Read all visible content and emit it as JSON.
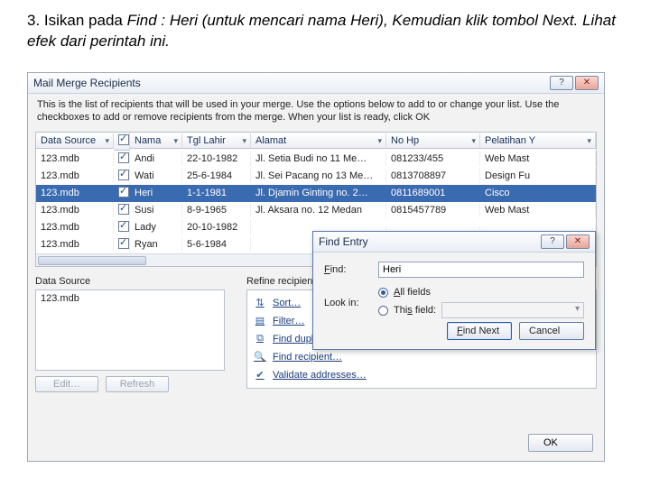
{
  "instruction": {
    "prefix": "3. Isikan pada ",
    "find_label": "Find",
    "middle": " : Heri (untuk mencari nama Heri), Kemudian klik tombol Next. Lihat efek dari perintah ini."
  },
  "main_dialog": {
    "title": "Mail Merge Recipients",
    "help_btn": "?",
    "close_btn": "✕",
    "intro": "This is the list of recipients that will be used in your merge. Use the options below to add to or change your list. Use the checkboxes to add or remove recipients from the merge. When your list is ready, click OK",
    "columns": [
      "Data Source",
      "",
      "Nama",
      "Tgl Lahir",
      "Alamat",
      "No Hp",
      "Pelatihan Y"
    ],
    "rows": [
      {
        "src": "123.mdb",
        "chk": true,
        "nama": "Andi",
        "tgl": "22-10-1982",
        "alamat": "Jl. Setia Budi no 11 Me…",
        "hp": "081233/455",
        "pel": "Web Mast"
      },
      {
        "src": "123.mdb",
        "chk": true,
        "nama": "Wati",
        "tgl": "25-6-1984",
        "alamat": "Jl. Sei Pacang no 13 Me…",
        "hp": "0813708897",
        "pel": "Design Fu"
      },
      {
        "src": "123.mdb",
        "chk": true,
        "nama": "Heri",
        "tgl": "1-1-1981",
        "alamat": "Jl. Djamin Ginting no. 2…",
        "hp": "0811689001",
        "pel": "Cisco",
        "selected": true
      },
      {
        "src": "123.mdb",
        "chk": true,
        "nama": "Susi",
        "tgl": "8-9-1965",
        "alamat": "Jl. Aksara no. 12 Medan",
        "hp": "0815457789",
        "pel": "Web Mast"
      },
      {
        "src": "123.mdb",
        "chk": true,
        "nama": "Lady",
        "tgl": "20-10-1982",
        "alamat": "",
        "hp": "",
        "pel": ""
      },
      {
        "src": "123.mdb",
        "chk": true,
        "nama": "Ryan",
        "tgl": "5-6-1984",
        "alamat": "",
        "hp": "",
        "pel": ""
      }
    ],
    "data_source_label": "Data Source",
    "data_source_item": "123.mdb",
    "edit_btn": "Edit…",
    "refresh_btn": "Refresh",
    "refine_label": "Refine recipient list",
    "refine_items": [
      {
        "icon": "⇅",
        "label": "Sort…"
      },
      {
        "icon": "▤",
        "label": "Filter…"
      },
      {
        "icon": "⧉",
        "label": "Find duplicates…"
      },
      {
        "icon": "🔍",
        "label": "Find recipient…"
      },
      {
        "icon": "✔",
        "label": "Validate addresses…"
      }
    ],
    "ok_btn": "OK"
  },
  "find_dialog": {
    "title": "Find Entry",
    "help_btn": "?",
    "close_btn": "✕",
    "find_label": "Find:",
    "find_value": "Heri",
    "look_in_label": "Look in:",
    "option_all": "All fields",
    "option_this": "This field:",
    "find_next_btn": "Find Next",
    "cancel_btn": "Cancel"
  }
}
